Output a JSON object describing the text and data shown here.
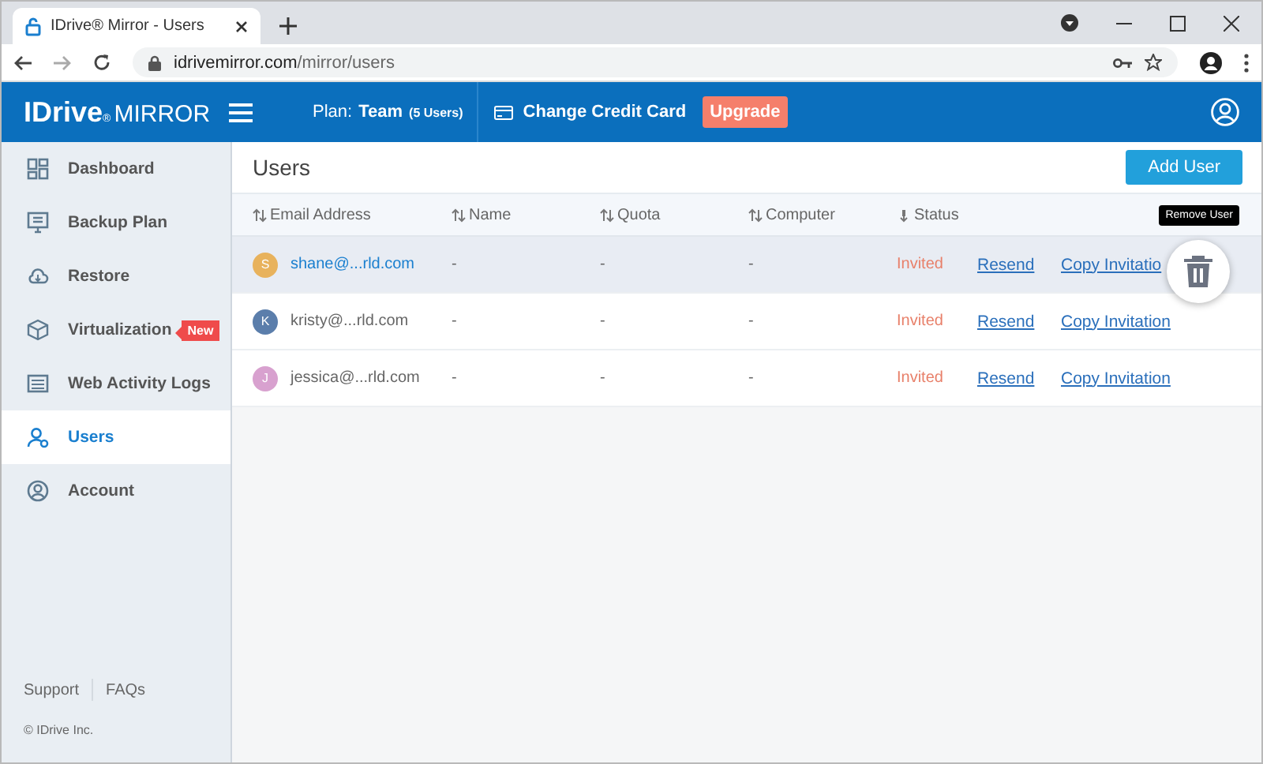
{
  "browser": {
    "tab_title": "IDrive® Mirror - Users",
    "url_host": "idrivemirror.com",
    "url_path": "/mirror/users"
  },
  "header": {
    "logo_brand": "IDrive",
    "logo_mark": "®",
    "logo_product": "MIRROR",
    "plan_label": "Plan:",
    "plan_name": "Team",
    "plan_users": "(5 Users)",
    "change_card": "Change Credit Card",
    "upgrade": "Upgrade"
  },
  "sidebar": {
    "items": [
      {
        "label": "Dashboard",
        "selected": false
      },
      {
        "label": "Backup Plan",
        "selected": false
      },
      {
        "label": "Restore",
        "selected": false
      },
      {
        "label": "Virtualization",
        "selected": false,
        "badge": "New"
      },
      {
        "label": "Web Activity Logs",
        "selected": false
      },
      {
        "label": "Users",
        "selected": true
      },
      {
        "label": "Account",
        "selected": false
      }
    ],
    "footer_links": [
      "Support",
      "FAQs"
    ],
    "copyright": "© IDrive Inc."
  },
  "page": {
    "title": "Users",
    "add_button": "Add User"
  },
  "table": {
    "columns": [
      {
        "label": "Email Address"
      },
      {
        "label": "Name"
      },
      {
        "label": "Quota"
      },
      {
        "label": "Computer"
      },
      {
        "label": "Status"
      }
    ],
    "rows": [
      {
        "initial": "S",
        "color": "#e8b25c",
        "email": "shane@...rld.com",
        "name": "-",
        "quota": "-",
        "computer": "-",
        "status": "Invited",
        "resend": "Resend",
        "copy": "Copy Invitatio",
        "selected": true
      },
      {
        "initial": "K",
        "color": "#5b7eab",
        "email": "kristy@...rld.com",
        "name": "-",
        "quota": "-",
        "computer": "-",
        "status": "Invited",
        "resend": "Resend",
        "copy": "Copy Invitation",
        "selected": false
      },
      {
        "initial": "J",
        "color": "#d8a1cf",
        "email": "jessica@...rld.com",
        "name": "-",
        "quota": "-",
        "computer": "-",
        "status": "Invited",
        "resend": "Resend",
        "copy": "Copy Invitation",
        "selected": false
      }
    ]
  },
  "tooltip": {
    "text": "Remove User"
  }
}
